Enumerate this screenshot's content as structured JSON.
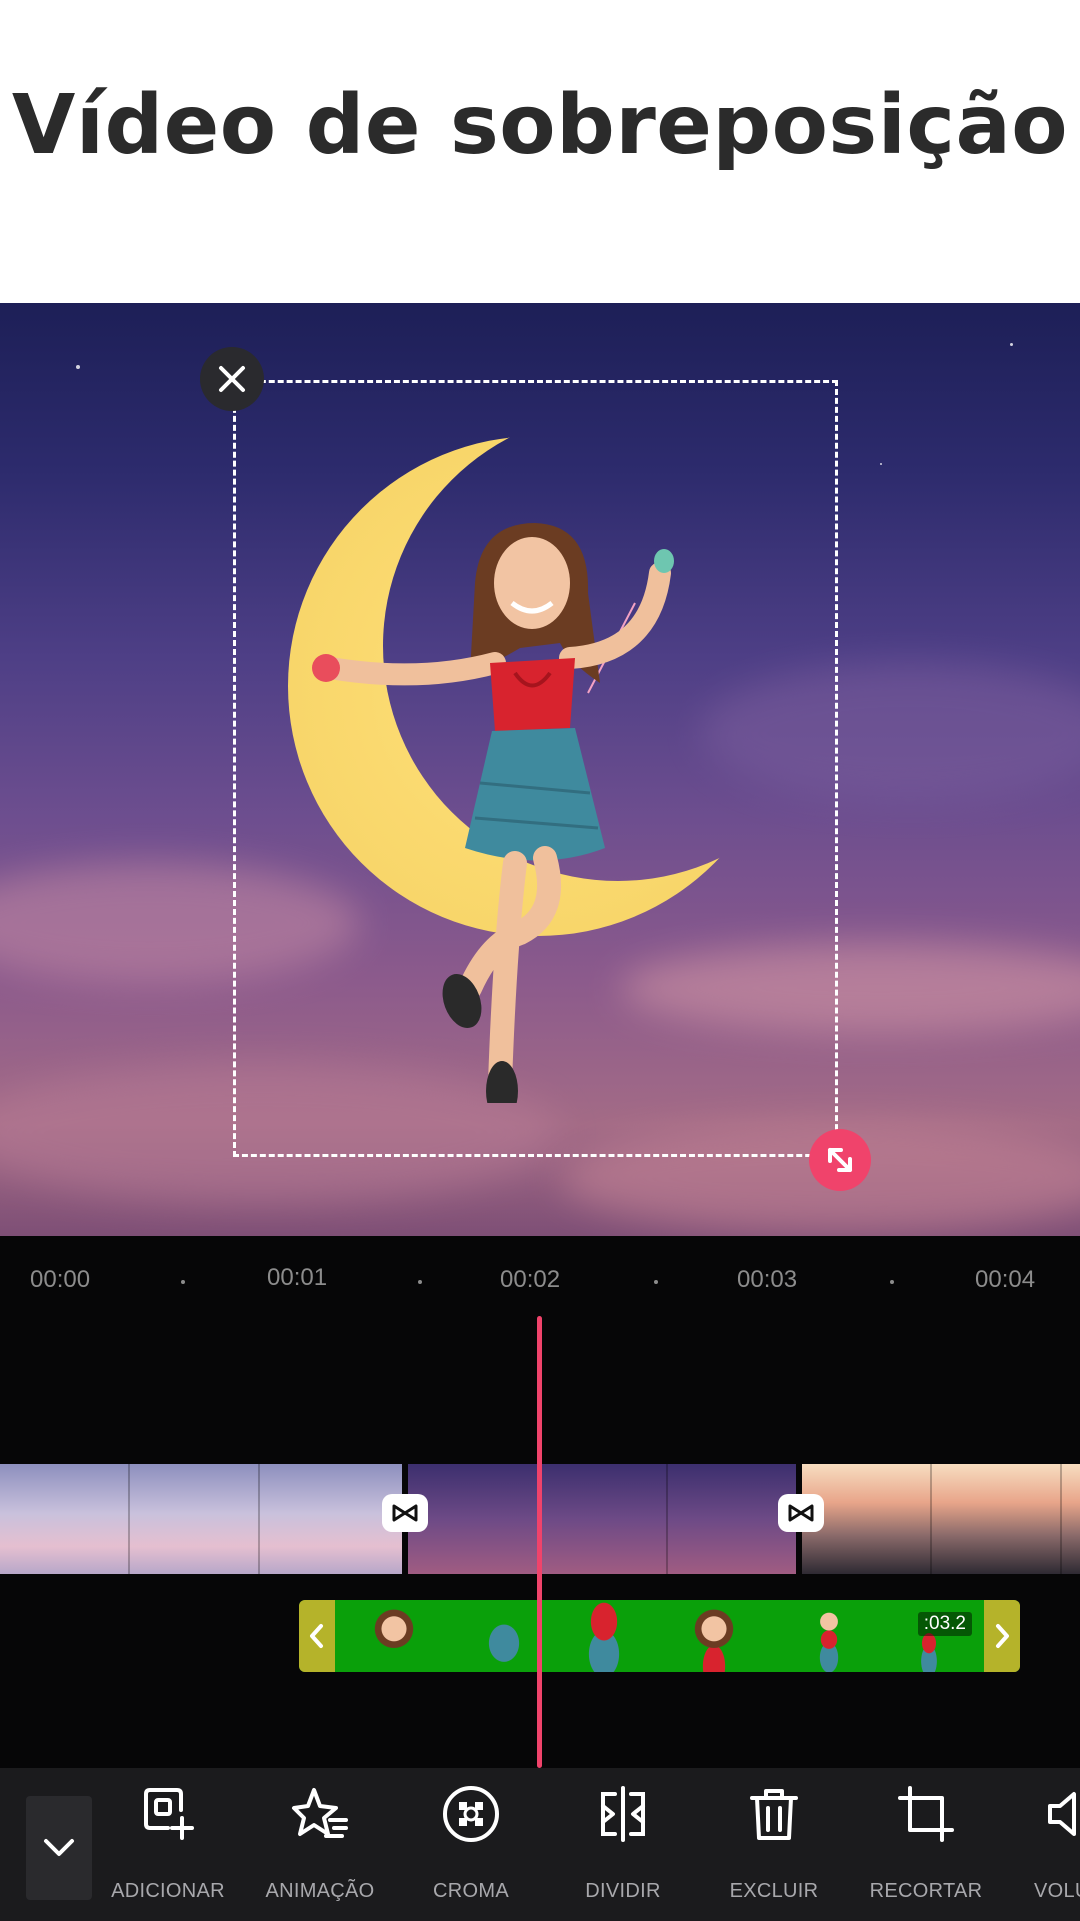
{
  "header": {
    "title": "Vídeo de sobreposição"
  },
  "timeline": {
    "ticks": [
      "00:00",
      "00:01",
      "00:02",
      "00:03",
      "00:04"
    ],
    "overlay_duration": ":03.2"
  },
  "toolbar": {
    "items": [
      {
        "label": "ADICIONAR",
        "icon": "add-overlay-icon"
      },
      {
        "label": "ANIMAÇÃO",
        "icon": "animation-icon"
      },
      {
        "label": "CROMA",
        "icon": "chroma-icon"
      },
      {
        "label": "DIVIDIR",
        "icon": "split-icon"
      },
      {
        "label": "EXCLUIR",
        "icon": "delete-icon"
      },
      {
        "label": "RECORTAR",
        "icon": "crop-icon"
      },
      {
        "label": "VOLU",
        "icon": "volume-icon"
      }
    ]
  },
  "colors": {
    "accent": "#f0436b",
    "overlay_track": "#0aa00a",
    "handle": "#b5b32a",
    "toolbar_bg": "#1b1b1d"
  }
}
